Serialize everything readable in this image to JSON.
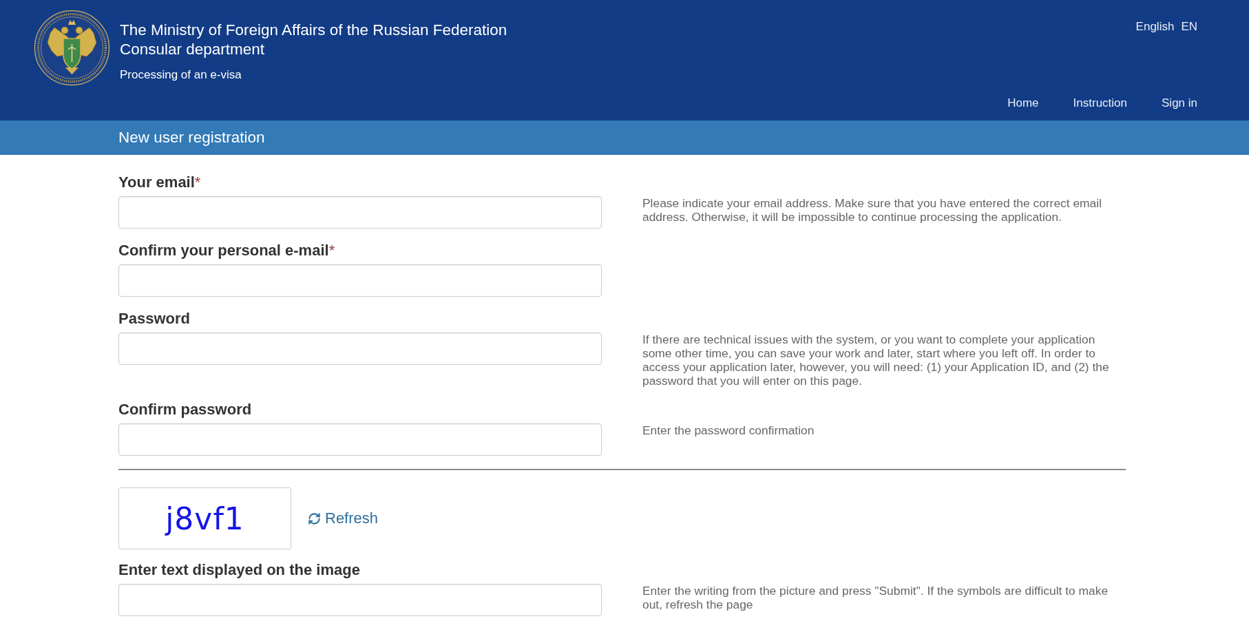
{
  "header": {
    "title": "The Ministry of Foreign Affairs of the Russian Federation",
    "subtitle": "Consular department",
    "tagline": "Processing of an e-visa",
    "language": {
      "name": "English",
      "code": "EN"
    },
    "nav": [
      "Home",
      "Instruction",
      "Sign in"
    ]
  },
  "page_title": "New user registration",
  "form": {
    "fields": [
      {
        "label": "Your email",
        "required_mark": "*",
        "help": "Please indicate your email address. Make sure that you have entered the correct email address. Otherwise, it will be impossible to continue processing the application."
      },
      {
        "label": "Confirm your personal e-mail",
        "required_mark": "*"
      },
      {
        "label": "Password",
        "help": "If there are technical issues with the system, or you want to complete your application some other time, you can save your work and later, start where you left off. In order to access your application later, however, you will need: (1) your Application ID, and (2) the password that you will enter on this page."
      },
      {
        "label": "Confirm password",
        "help": "Enter the password confirmation"
      }
    ],
    "captcha": {
      "text": "j8vf1",
      "refresh": "Refresh"
    },
    "captcha_field": {
      "label": "Enter text displayed on the image",
      "help": "Enter the writing from the picture and press \"Submit\". If the symbols are difficult to make out, refresh the page"
    }
  }
}
